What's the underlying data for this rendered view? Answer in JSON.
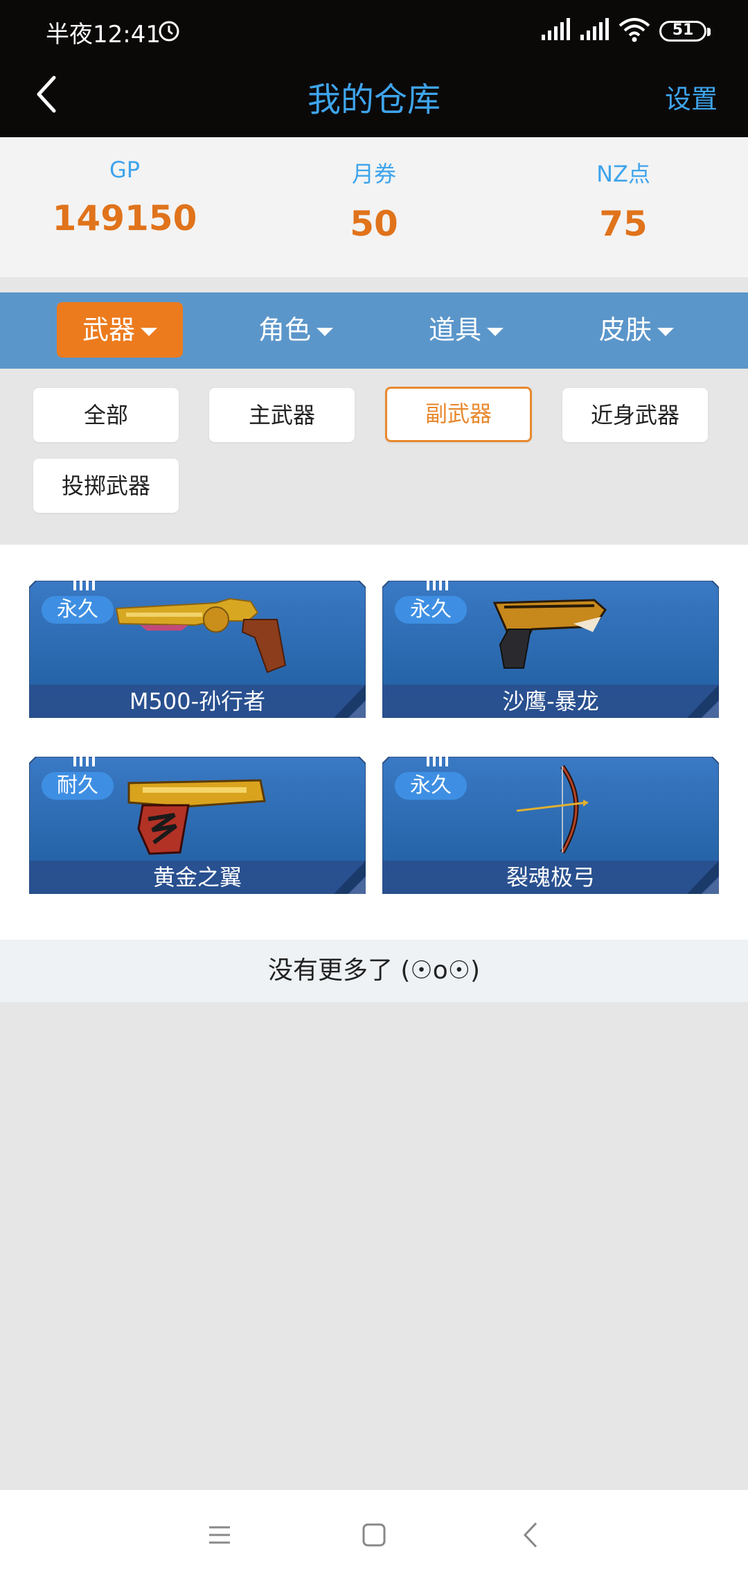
{
  "status_bar": {
    "time": "半夜12:41",
    "battery": "51"
  },
  "header": {
    "title": "我的仓库",
    "settings_label": "设置"
  },
  "currency": [
    {
      "label": "GP",
      "value": "149150"
    },
    {
      "label": "月券",
      "value": "50"
    },
    {
      "label": "NZ点",
      "value": "75"
    }
  ],
  "categories": [
    {
      "label": "武器",
      "active": true
    },
    {
      "label": "角色",
      "active": false
    },
    {
      "label": "道具",
      "active": false
    },
    {
      "label": "皮肤",
      "active": false
    }
  ],
  "filters": [
    {
      "label": "全部",
      "active": false
    },
    {
      "label": "主武器",
      "active": false
    },
    {
      "label": "副武器",
      "active": true
    },
    {
      "label": "近身武器",
      "active": false
    },
    {
      "label": "投掷武器",
      "active": false
    }
  ],
  "items": [
    {
      "badge": "永久",
      "name": "M500-孙行者",
      "icon": "revolver-icon"
    },
    {
      "badge": "永久",
      "name": "沙鹰-暴龙",
      "icon": "dragon-pistol-icon"
    },
    {
      "badge": "耐久",
      "name": "黄金之翼",
      "icon": "golden-pistol-icon"
    },
    {
      "badge": "永久",
      "name": "裂魂极弓",
      "icon": "bow-icon"
    }
  ],
  "footer_message": "没有更多了 (☉o☉)",
  "colors": {
    "accent_blue": "#3ea4ec",
    "accent_orange": "#ec7b1e",
    "category_bar": "#5b96ca",
    "value_orange": "#e0731b"
  }
}
